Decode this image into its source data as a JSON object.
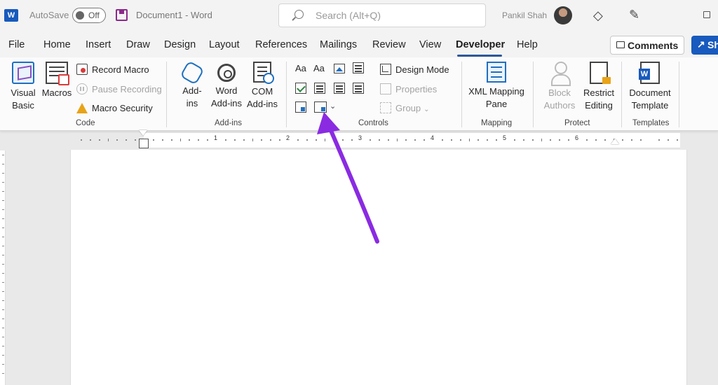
{
  "titlebar": {
    "app_icon": "W",
    "autosave_label": "AutoSave",
    "autosave_state": "Off",
    "document_title": "Document1 - Word",
    "search_placeholder": "Search (Alt+Q)",
    "user_name": "Pankil Shah"
  },
  "tabs": [
    "File",
    "Home",
    "Insert",
    "Draw",
    "Design",
    "Layout",
    "References",
    "Mailings",
    "Review",
    "View",
    "Developer",
    "Help"
  ],
  "active_tab": "Developer",
  "comments_label": "Comments",
  "share_label": "Sh",
  "ribbon": {
    "code": {
      "label": "Code",
      "visual_basic": "Visual Basic",
      "macros": "Macros",
      "record_macro": "Record Macro",
      "pause_recording": "Pause Recording",
      "macro_security": "Macro Security"
    },
    "addins": {
      "label": "Add-ins",
      "addins": "Add-ins",
      "word_addins": "Word Add-ins",
      "com_addins": "COM Add-ins"
    },
    "controls": {
      "label": "Controls",
      "design_mode": "Design Mode",
      "properties": "Properties",
      "group": "Group"
    },
    "mapping": {
      "label": "Mapping",
      "xml_mapping_pane": "XML Mapping Pane"
    },
    "protect": {
      "label": "Protect",
      "block_authors": "Block Authors",
      "restrict_editing": "Restrict Editing"
    },
    "templates": {
      "label": "Templates",
      "document_template": "Document Template"
    }
  },
  "ruler": {
    "numbers": [
      "1",
      "2",
      "3",
      "4",
      "5",
      "6"
    ]
  },
  "colors": {
    "accent": "#2b579a",
    "share_button": "#185abd",
    "annotation_arrow": "#8a2be2"
  }
}
